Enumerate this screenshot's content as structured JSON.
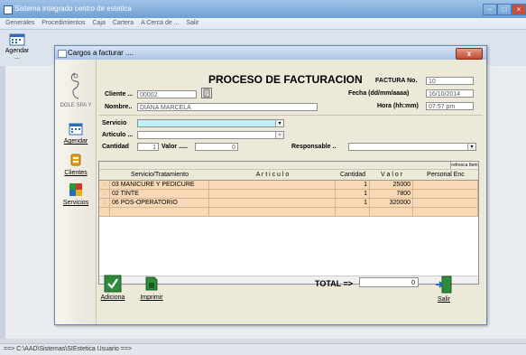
{
  "app": {
    "title": "Sistema integrado centro de estetica",
    "menu": [
      "Generales",
      "Procedimientos",
      "Caja",
      "Cartera",
      "A Cerca de ...",
      "Salir"
    ],
    "toolbar": [
      {
        "label": "Agendar ..."
      }
    ],
    "status": "==> C:\\AAD\\Sistemas\\SIEstetica    Usuario ==>"
  },
  "dialog": {
    "title": "Cargos a facturar ....",
    "close": "x",
    "heading": "PROCESO DE FACTURACION",
    "factura_label": "FACTURA No.",
    "factura_value": "10",
    "fecha_label": "Fecha (dd/mm/aaaa)",
    "fecha_value": "16/10/2014",
    "hora_label": "Hora (hh:mm)",
    "hora_value": "07:57 pm",
    "cliente_label": "Cliente ...",
    "cliente_value": "00002",
    "nombre_label": "Nombre..",
    "nombre_value": "DIANA MARCELA",
    "servicio_label": "Servicio",
    "articulo_label": "Articulo ...",
    "cantidad_label": "Cantidad",
    "cantidad_value": "1",
    "valor_label": "Valor .....",
    "valor_value": "0",
    "responsable_label": "Responsable ..",
    "refresh_label": "refresca Item",
    "total_label": "TOTAL =>",
    "total_value": "0",
    "logo_text": "DOLE SPA Y"
  },
  "side": [
    {
      "label": "Agendar",
      "icon": "calendar-icon"
    },
    {
      "label": "Clientes",
      "icon": "clients-icon"
    },
    {
      "label": "Servicios",
      "icon": "services-icon"
    }
  ],
  "grid": {
    "columns": [
      "Servicio/Tratamiento",
      "A r t i c u l o",
      "Cantidad",
      "V a l o r",
      "Personal Enc"
    ],
    "rows": [
      {
        "servicio": "03 MANICURE Y PEDICURE",
        "articulo": "",
        "cantidad": "1",
        "valor": "25000",
        "personal": ""
      },
      {
        "servicio": "02 TINTE",
        "articulo": "",
        "cantidad": "1",
        "valor": "7800",
        "personal": ""
      },
      {
        "servicio": "06 POS-OPERATORIO",
        "articulo": "",
        "cantidad": "1",
        "valor": "320000",
        "personal": ""
      }
    ]
  },
  "buttons": {
    "adiciona": "Adiciona",
    "imprimir": "Imprimir",
    "salir": "Salir"
  },
  "colors": {
    "row_fill": "#f7d9b7",
    "servicio_field": "#bdf0f7",
    "dialog_bg": "#ece9d8",
    "close_red": "#c04b30"
  }
}
